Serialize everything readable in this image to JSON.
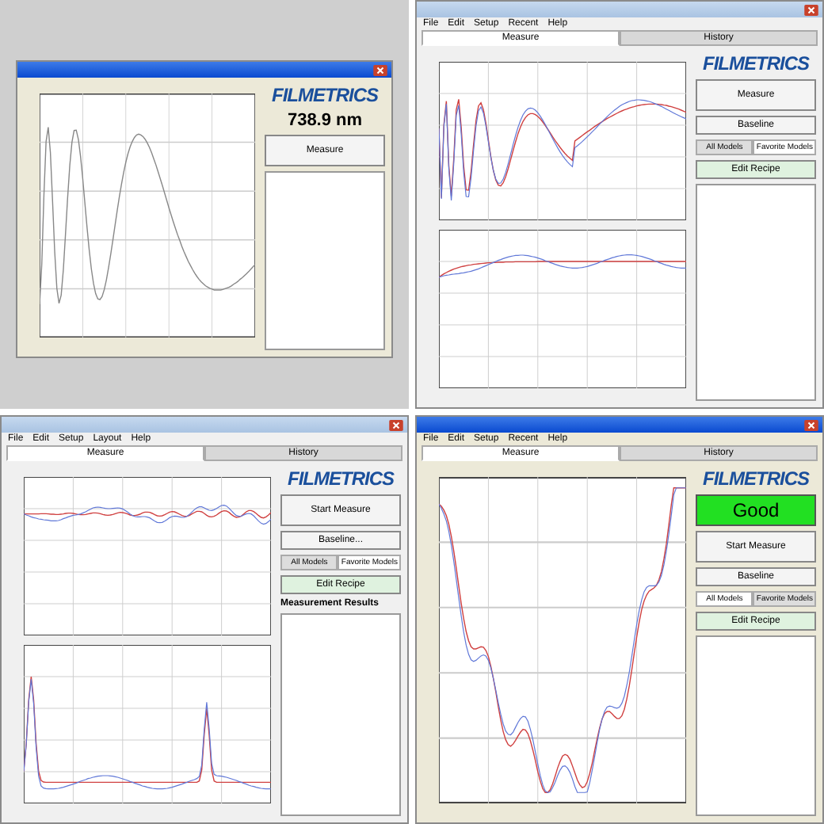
{
  "panels": [
    {
      "kind": "inset-xp",
      "logo": "FILMETRICS",
      "reading": "738.9 nm",
      "buttons": [
        "Measure"
      ],
      "plots": [
        {
          "kind": "picture"
        }
      ]
    },
    {
      "kind": "win7",
      "menus": [
        "File",
        "Edit",
        "Setup",
        "Recent",
        "Help"
      ],
      "tabs": [
        {
          "label": "Measure",
          "selected": true
        },
        {
          "label": "History",
          "selected": false
        }
      ],
      "logo": "FILMETRICS",
      "buttons": [
        "Measure",
        "Baseline"
      ],
      "model_tabs": [
        {
          "label": "All Models",
          "selected": false
        },
        {
          "label": "Favorite Models",
          "selected": true
        }
      ],
      "recipe_button": "Edit Recipe",
      "plots": [
        {
          "kind": "picture"
        },
        {
          "kind": "picture"
        }
      ]
    },
    {
      "kind": "win7",
      "menus": [
        "File",
        "Edit",
        "Setup",
        "Layout",
        "Help"
      ],
      "tabs": [
        {
          "label": "Measure",
          "selected": true
        },
        {
          "label": "History",
          "selected": false
        }
      ],
      "logo": "FILMETRICS",
      "buttons": [
        "Start Measure",
        "Baseline..."
      ],
      "model_tabs": [
        {
          "label": "All Models",
          "selected": false
        },
        {
          "label": "Favorite Models",
          "selected": true
        }
      ],
      "recipe_button": "Edit Recipe",
      "results_title": "Measurement Results",
      "plots": [
        {
          "kind": "picture"
        },
        {
          "kind": "picture"
        }
      ]
    },
    {
      "kind": "xp",
      "menus": [
        "File",
        "Edit",
        "Setup",
        "Recent",
        "Help"
      ],
      "tabs": [
        {
          "label": "Measure",
          "selected": true
        },
        {
          "label": "History",
          "selected": false
        }
      ],
      "logo": "FILMETRICS",
      "status": "Good",
      "buttons": [
        "Start Measure",
        "Baseline"
      ],
      "model_tabs": [
        {
          "label": "All Models",
          "selected": true
        },
        {
          "label": "Favorite Models",
          "selected": false
        }
      ],
      "recipe_button": "Edit Recipe",
      "plots": [
        {
          "kind": "picture"
        }
      ]
    }
  ]
}
